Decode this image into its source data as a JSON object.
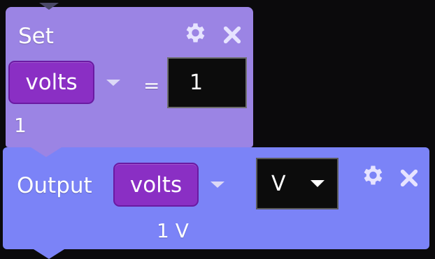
{
  "set_block": {
    "title": "Set",
    "variable": "volts",
    "operator": "=",
    "value": "1",
    "result": "1"
  },
  "output_block": {
    "title": "Output",
    "variable": "volts",
    "unit": "V",
    "result": "1 V"
  },
  "colors": {
    "set_block_bg": "#9b84e4",
    "output_block_bg": "#7b83f7",
    "variable_pill": "#8a2fc4",
    "icon_color": "#e6e3ff"
  },
  "icons": [
    "gear-icon",
    "close-icon",
    "chevron-down-icon"
  ]
}
